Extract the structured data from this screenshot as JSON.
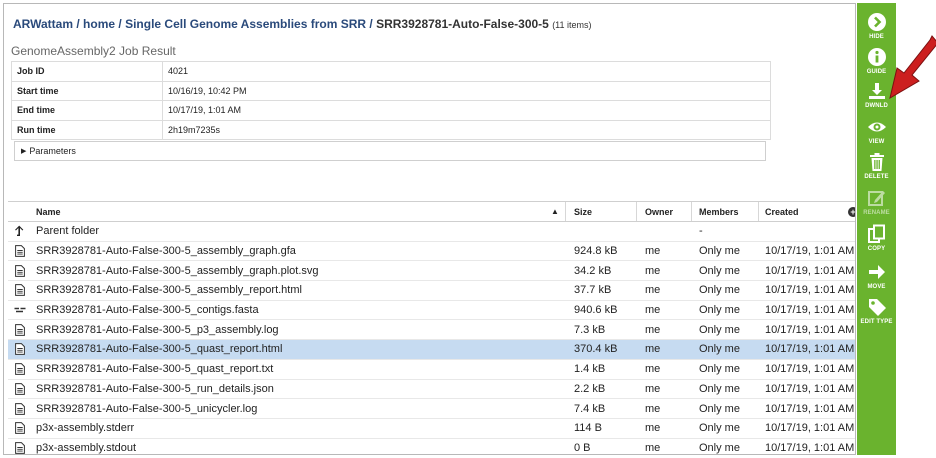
{
  "breadcrumb": {
    "root": "ARWattam",
    "home": "home",
    "folder": "Single Cell Genome Assemblies from SRR",
    "current": "SRR3928781-Auto-False-300-5",
    "count": "(11 items)",
    "separator": "/"
  },
  "job": {
    "title": "GenomeAssembly2 Job Result",
    "rows": [
      {
        "key": "Job ID",
        "value": "4021"
      },
      {
        "key": "Start time",
        "value": "10/16/19, 10:42 PM"
      },
      {
        "key": "End time",
        "value": "10/17/19, 1:01 AM"
      },
      {
        "key": "Run time",
        "value": "2h19m7235s"
      }
    ],
    "parameters_label": "Parameters"
  },
  "table": {
    "headers": {
      "name": "Name",
      "size": "Size",
      "owner": "Owner",
      "members": "Members",
      "created": "Created"
    },
    "parent_label": "Parent folder",
    "parent_members": "-",
    "rows": [
      {
        "name": "SRR3928781-Auto-False-300-5_assembly_graph.gfa",
        "size": "924.8 kB",
        "owner": "me",
        "members": "Only me",
        "created": "10/17/19, 1:01 AM",
        "icon": "doc-icon"
      },
      {
        "name": "SRR3928781-Auto-False-300-5_assembly_graph.plot.svg",
        "size": "34.2 kB",
        "owner": "me",
        "members": "Only me",
        "created": "10/17/19, 1:01 AM",
        "icon": "doc-icon"
      },
      {
        "name": "SRR3928781-Auto-False-300-5_assembly_report.html",
        "size": "37.7 kB",
        "owner": "me",
        "members": "Only me",
        "created": "10/17/19, 1:01 AM",
        "icon": "doc-icon"
      },
      {
        "name": "SRR3928781-Auto-False-300-5_contigs.fasta",
        "size": "940.6 kB",
        "owner": "me",
        "members": "Only me",
        "created": "10/17/19, 1:01 AM",
        "icon": "contigs-icon"
      },
      {
        "name": "SRR3928781-Auto-False-300-5_p3_assembly.log",
        "size": "7.3 kB",
        "owner": "me",
        "members": "Only me",
        "created": "10/17/19, 1:01 AM",
        "icon": "doc-icon"
      },
      {
        "name": "SRR3928781-Auto-False-300-5_quast_report.html",
        "size": "370.4 kB",
        "owner": "me",
        "members": "Only me",
        "created": "10/17/19, 1:01 AM",
        "icon": "doc-icon",
        "selected": true
      },
      {
        "name": "SRR3928781-Auto-False-300-5_quast_report.txt",
        "size": "1.4 kB",
        "owner": "me",
        "members": "Only me",
        "created": "10/17/19, 1:01 AM",
        "icon": "doc-icon"
      },
      {
        "name": "SRR3928781-Auto-False-300-5_run_details.json",
        "size": "2.2 kB",
        "owner": "me",
        "members": "Only me",
        "created": "10/17/19, 1:01 AM",
        "icon": "doc-icon"
      },
      {
        "name": "SRR3928781-Auto-False-300-5_unicycler.log",
        "size": "7.4 kB",
        "owner": "me",
        "members": "Only me",
        "created": "10/17/19, 1:01 AM",
        "icon": "doc-icon"
      },
      {
        "name": "p3x-assembly.stderr",
        "size": "114 B",
        "owner": "me",
        "members": "Only me",
        "created": "10/17/19, 1:01 AM",
        "icon": "doc-icon"
      },
      {
        "name": "p3x-assembly.stdout",
        "size": "0 B",
        "owner": "me",
        "members": "Only me",
        "created": "10/17/19, 1:01 AM",
        "icon": "doc-icon"
      }
    ]
  },
  "sidebar": {
    "items": [
      {
        "label": "HIDE",
        "icon": "chevron-right-circle-icon"
      },
      {
        "label": "GUIDE",
        "icon": "info-circle-icon"
      },
      {
        "label": "DWNLD",
        "icon": "download-icon"
      },
      {
        "label": "VIEW",
        "icon": "eye-icon"
      },
      {
        "label": "DELETE",
        "icon": "trash-icon"
      },
      {
        "label": "RENAME",
        "icon": "edit-icon"
      },
      {
        "label": "COPY",
        "icon": "copy-icon"
      },
      {
        "label": "MOVE",
        "icon": "arrow-right-icon"
      },
      {
        "label": "EDIT TYPE",
        "icon": "tag-icon"
      }
    ]
  },
  "colors": {
    "sidebar": "#6ab32e",
    "selected_row": "#c6dbf1",
    "link": "#2a4a7b",
    "annotation_arrow": "#cc1f1f"
  }
}
